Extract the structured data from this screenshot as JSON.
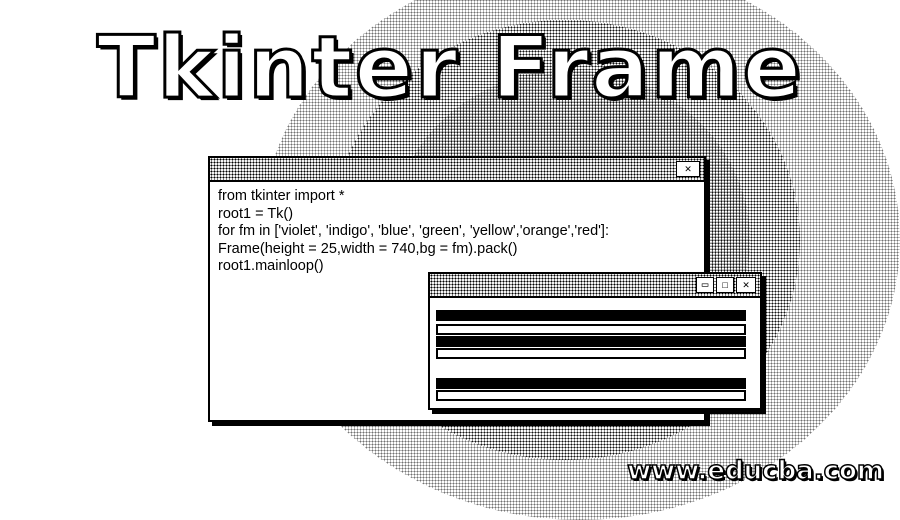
{
  "headline": "Tkinter Frame",
  "code_window": {
    "close_glyph": "✕",
    "lines": [
      "from tkinter import *",
      "root1 = Tk()",
      "for fm in ['violet', 'indigo', 'blue', 'green', 'yellow','orange','red']:",
      "Frame(height = 25,width = 740,bg = fm).pack()",
      "root1.mainloop()"
    ]
  },
  "output_window": {
    "minimize_glyph": "▭",
    "maximize_glyph": "☐",
    "close_glyph": "✕",
    "frames": [
      "violet",
      "indigo",
      "blue",
      "green",
      "yellow",
      "orange",
      "red"
    ]
  },
  "brand": "www.educba.com",
  "colors": {
    "ink": "#000000",
    "paper": "#ffffff"
  }
}
